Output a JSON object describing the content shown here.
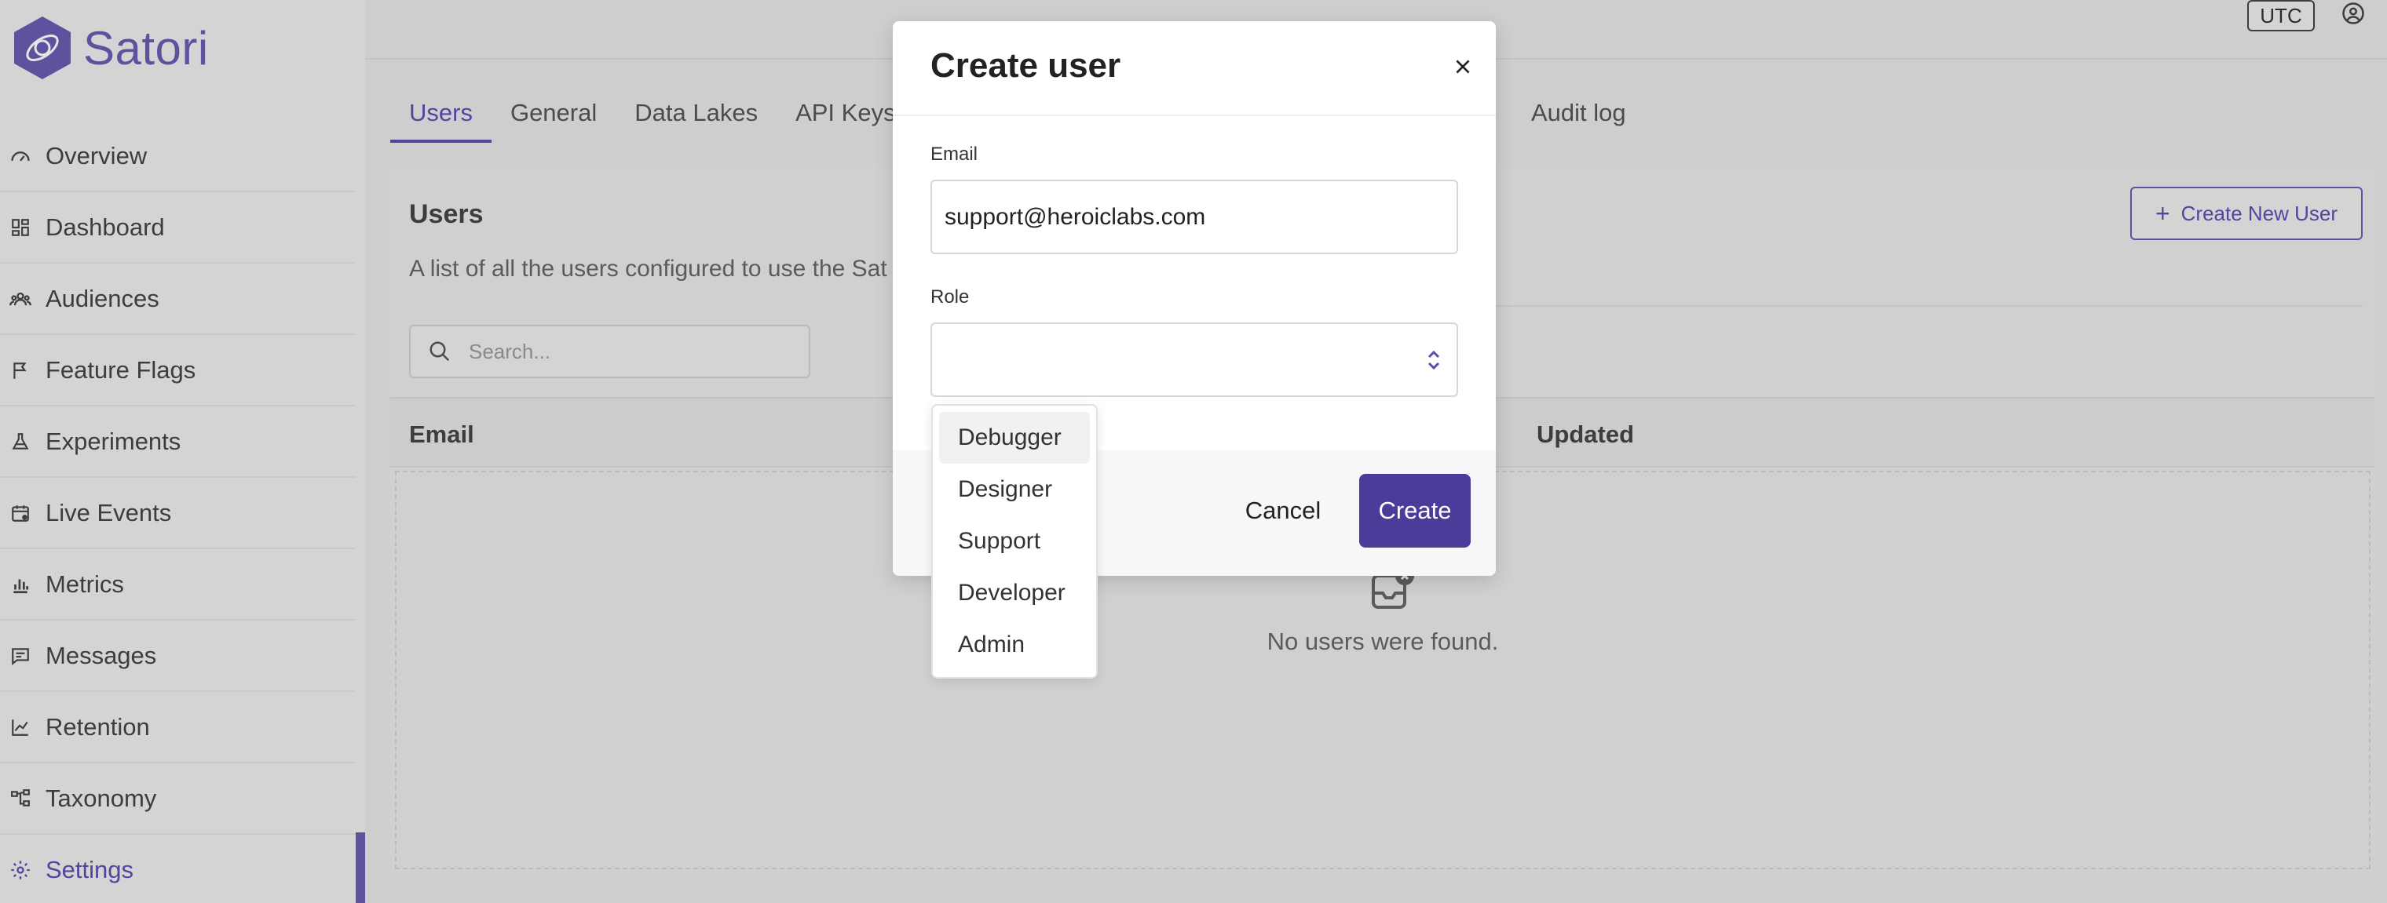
{
  "brand": {
    "name": "Satori"
  },
  "sidebar": {
    "items": [
      {
        "label": "Overview",
        "icon": "gauge-icon"
      },
      {
        "label": "Dashboard",
        "icon": "dashboard-icon"
      },
      {
        "label": "Audiences",
        "icon": "people-icon"
      },
      {
        "label": "Feature Flags",
        "icon": "flag-icon"
      },
      {
        "label": "Experiments",
        "icon": "flask-icon"
      },
      {
        "label": "Live Events",
        "icon": "calendar-icon"
      },
      {
        "label": "Metrics",
        "icon": "bar-chart-icon"
      },
      {
        "label": "Messages",
        "icon": "message-icon"
      },
      {
        "label": "Retention",
        "icon": "trend-icon"
      },
      {
        "label": "Taxonomy",
        "icon": "hierarchy-icon"
      },
      {
        "label": "Settings",
        "icon": "gear-icon",
        "active": true
      }
    ]
  },
  "topbar": {
    "timezone": "UTC"
  },
  "tabs": {
    "users": "Users",
    "general": "General",
    "data_lakes": "Data Lakes",
    "api_keys": "API Keys",
    "audit_log": "Audit log"
  },
  "users_panel": {
    "title": "Users",
    "description": "A list of all the users configured to use the Sat",
    "create_button": "Create New User",
    "search_placeholder": "Search...",
    "columns": {
      "email": "Email",
      "updated": "Updated"
    },
    "empty_text": "No users were found."
  },
  "modal": {
    "title": "Create user",
    "email_label": "Email",
    "email_value": "support@heroiclabs.com",
    "role_label": "Role",
    "role_value": "",
    "cancel_label": "Cancel",
    "create_label": "Create"
  },
  "role_options": [
    "Debugger",
    "Designer",
    "Support",
    "Developer",
    "Admin"
  ],
  "colors": {
    "accent": "#5b4db0",
    "primary_button": "#4a3d99"
  }
}
